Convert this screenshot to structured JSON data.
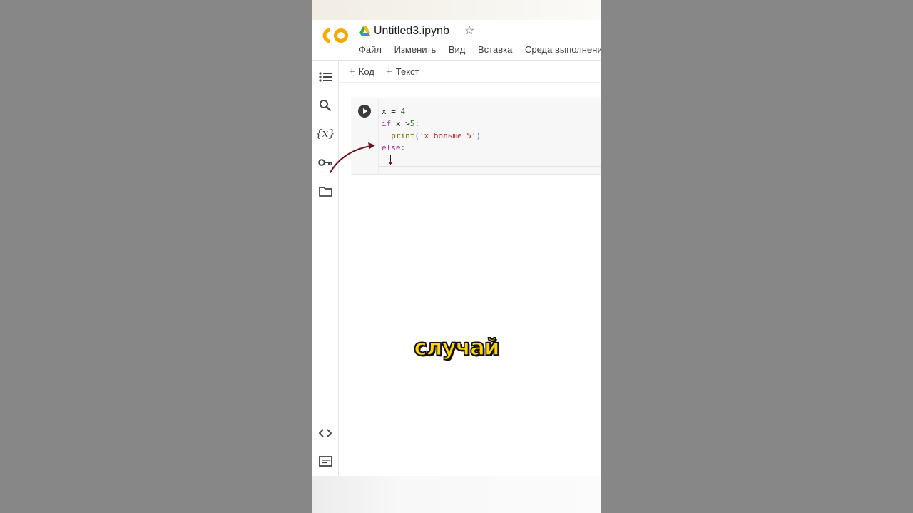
{
  "app": {
    "title": "Untitled3.ipynb",
    "logo_colors": {
      "orange": "#f9ab00",
      "yellow": "#f2c32d"
    }
  },
  "menu": {
    "items": [
      "Файл",
      "Изменить",
      "Вид",
      "Вставка",
      "Среда выполнения"
    ]
  },
  "toolbar": {
    "add_code_label": "Код",
    "add_text_label": "Текст"
  },
  "sidebar": {
    "icons": [
      "table-of-contents-icon",
      "search-icon",
      "variables-icon",
      "key-icon",
      "folder-icon",
      "code-snippets-icon",
      "terminal-icon"
    ],
    "variables_glyph": "{x}"
  },
  "cell": {
    "lines": [
      "x = 4",
      "if x >5:",
      "  print('x больше 5')",
      "else:"
    ]
  },
  "subtitle": "случай"
}
